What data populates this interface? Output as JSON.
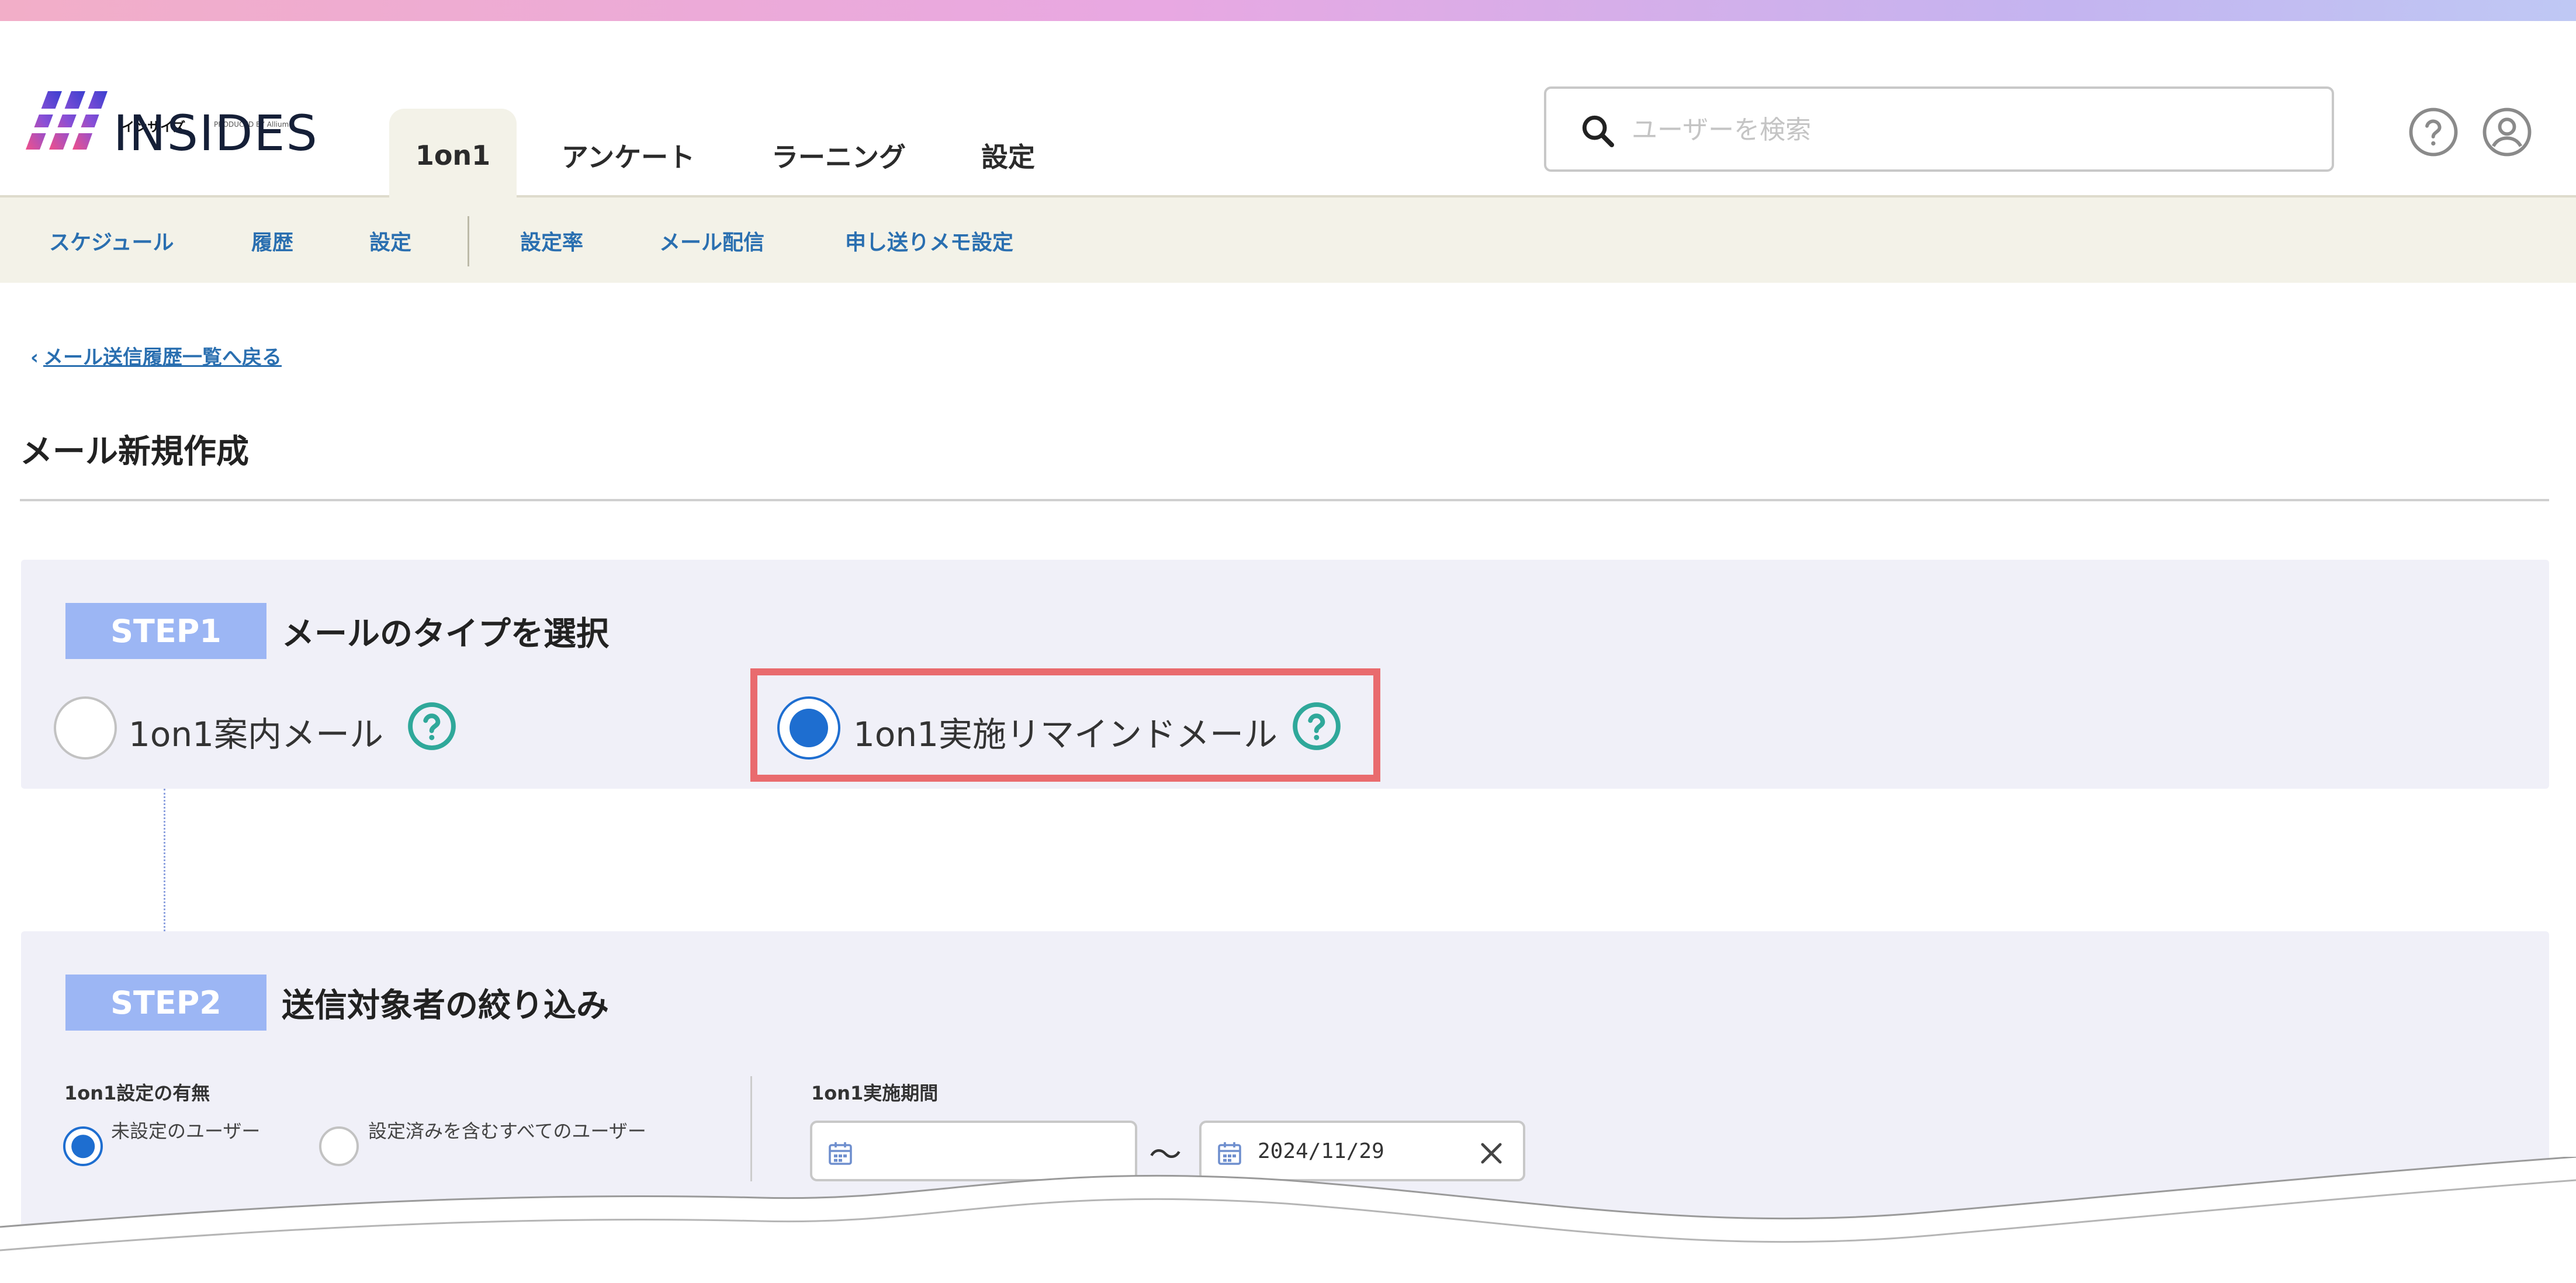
{
  "brand": {
    "name": "INSIDES",
    "kana": "インサイズ",
    "produced_by": "PRODUCED BY",
    "company": "Allium"
  },
  "nav": {
    "tabs": [
      {
        "label": "1on1",
        "active": true
      },
      {
        "label": "アンケート"
      },
      {
        "label": "ラーニング"
      },
      {
        "label": "設定"
      }
    ]
  },
  "search": {
    "placeholder": "ユーザーを検索"
  },
  "header_icons": [
    "help-icon",
    "account-icon"
  ],
  "subnav": {
    "items": [
      {
        "label": "スケジュール"
      },
      {
        "label": "履歴"
      },
      {
        "label": "設定"
      },
      {
        "label": "設定率"
      },
      {
        "label": "メール配信"
      },
      {
        "label": "申し送りメモ設定"
      }
    ]
  },
  "back_link": {
    "chevron": "‹",
    "label": "メール送信履歴一覧へ戻る"
  },
  "page_title": "メール新規作成",
  "step1": {
    "badge": "STEP1",
    "heading": "メールのタイプを選択",
    "options": [
      {
        "label": "1on1案内メール",
        "checked": false
      },
      {
        "label": "1on1実施リマインドメール",
        "checked": true
      }
    ]
  },
  "step2": {
    "badge": "STEP2",
    "heading": "送信対象者の絞り込み",
    "setting": {
      "label": "1on1設定の有無",
      "options": [
        {
          "label": "未設定のユーザー",
          "checked": true
        },
        {
          "label": "設定済みを含むすべてのユーザー",
          "checked": false
        }
      ]
    },
    "period": {
      "label": "1on1実施期間",
      "start_value": "",
      "separator": "～",
      "end_value": "2024/11/29"
    }
  },
  "colors": {
    "accent": "#1e6ed0",
    "link": "#2a6fb0",
    "step_badge": "#9cb6f4",
    "panel_bg": "#f0f0f8",
    "subnav_bg": "#f3f2e8",
    "highlight": "#e96b6e",
    "help_icon": "#2fa89a"
  }
}
